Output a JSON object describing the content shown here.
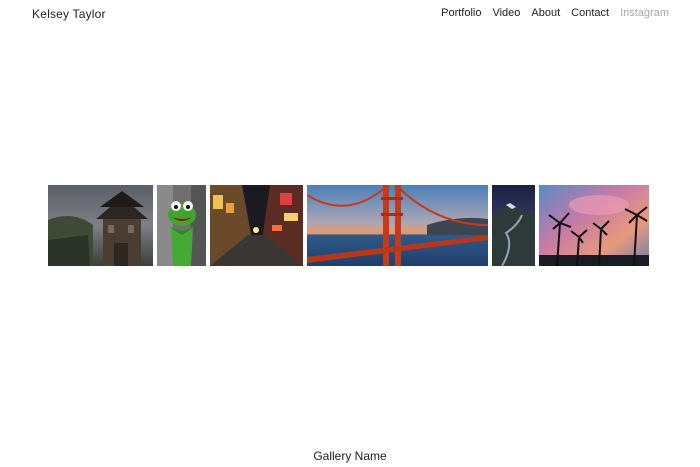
{
  "site": {
    "title": "Kelsey Taylor"
  },
  "nav": {
    "items": [
      {
        "label": "Portfolio"
      },
      {
        "label": "Video"
      },
      {
        "label": "About"
      },
      {
        "label": "Contact"
      },
      {
        "label": "Instagram"
      }
    ]
  },
  "gallery": {
    "name": "Gallery Name",
    "thumbnails": [
      {
        "subject": "pagoda-tower"
      },
      {
        "subject": "kermit-frog"
      },
      {
        "subject": "city-street-night"
      },
      {
        "subject": "golden-gate-bridge"
      },
      {
        "subject": "mountain-moonrise"
      },
      {
        "subject": "palm-trees-sunset"
      }
    ]
  },
  "colors": {
    "text": "#222222",
    "muted_nav": "#a8a8a8",
    "background": "#ffffff"
  }
}
